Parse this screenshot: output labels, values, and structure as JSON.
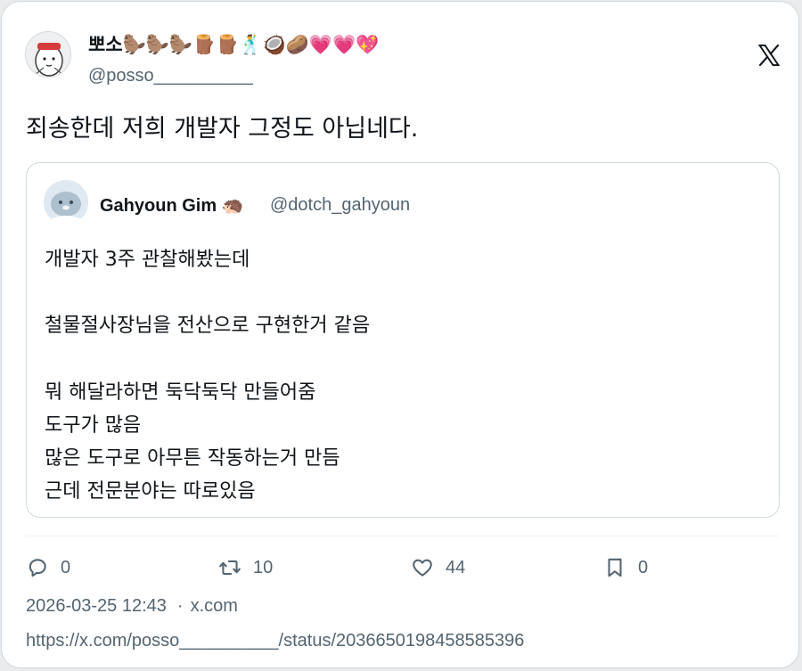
{
  "author": {
    "display_name": "뽀소🦫🦫🦫🪵🪵🕺🥥🥔💗💗💖",
    "handle": "@posso__________"
  },
  "tweet": {
    "text": "죄송한데 저희 개발자 그정도 아닙네다."
  },
  "quoted": {
    "display_name": "Gahyoun Gim 🦔",
    "handle": "@dotch_gahyoun",
    "lines": [
      "개발자 3주 관찰해봤는데",
      "",
      "철물절사장님을 전산으로 구현한거 같음",
      "",
      "뭐 해달라하면 둑닥둑닥 만들어줌",
      "도구가 많음",
      "많은 도구로 아무튼 작동하는거 만듬",
      "근데 전문분야는 따로있음"
    ]
  },
  "actions": {
    "replies": "0",
    "retweets": "10",
    "likes": "44",
    "bookmarks": "0"
  },
  "meta": {
    "timestamp": "2026-03-25 12:43",
    "separator": "·",
    "domain": "x.com",
    "url": "https://x.com/posso__________/status/2036650198458585396"
  },
  "icons": {
    "brand": "x-logo-icon",
    "reply": "reply-icon",
    "retweet": "retweet-icon",
    "like": "heart-icon",
    "bookmark": "bookmark-icon"
  },
  "colors": {
    "text": "#0f1419",
    "muted": "#536471",
    "border": "#cfd9de"
  }
}
